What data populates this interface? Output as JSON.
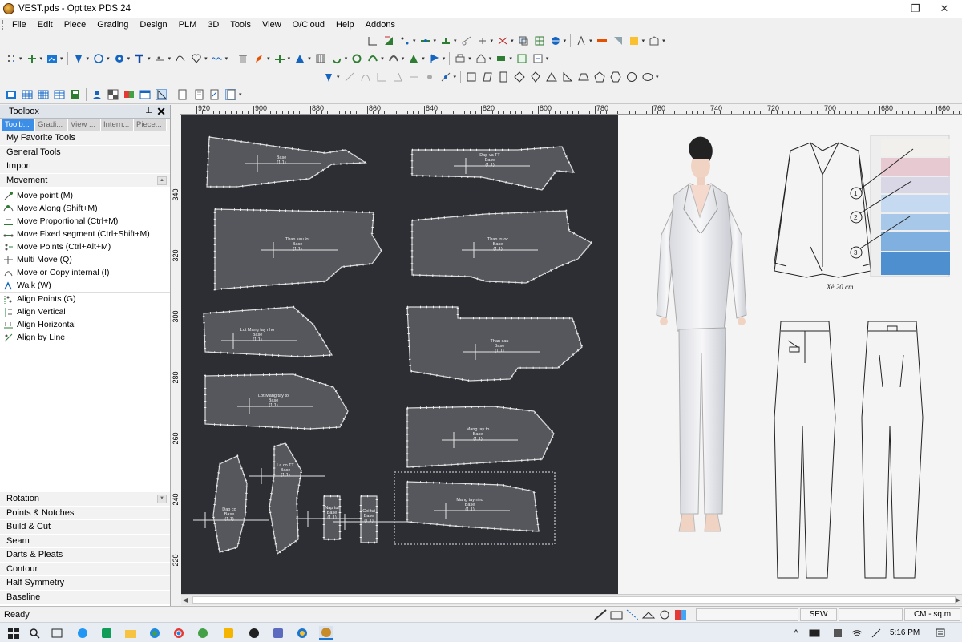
{
  "window": {
    "title": "VEST.pds - Optitex PDS 24",
    "minimize_glyph": "—",
    "restore_glyph": "❐",
    "close_glyph": "✕"
  },
  "menu": [
    "File",
    "Edit",
    "Piece",
    "Grading",
    "Design",
    "PLM",
    "3D",
    "Tools",
    "View",
    "O/Cloud",
    "Help",
    "Addons"
  ],
  "toolbox": {
    "title": "Toolbox",
    "pin": "📌",
    "close": "✕",
    "tabs": [
      "Toolb...",
      "Gradi...",
      "View ...",
      "Intern...",
      "Piece..."
    ],
    "top_categories": [
      "My Favorite Tools",
      "General Tools",
      "Import"
    ],
    "movement": {
      "label": "Movement",
      "tools": [
        {
          "label": "Move point (M)",
          "icon": "move-point-icon"
        },
        {
          "label": "Move Along (Shift+M)",
          "icon": "move-along-icon"
        },
        {
          "label": "Move Proportional (Ctrl+M)",
          "icon": "move-proportional-icon"
        },
        {
          "label": "Move Fixed segment (Ctrl+Shift+M)",
          "icon": "move-fixed-segment-icon"
        },
        {
          "label": "Move Points (Ctrl+Alt+M)",
          "icon": "move-points-icon"
        },
        {
          "label": "Multi Move (Q)",
          "icon": "multi-move-icon"
        },
        {
          "label": "Move or Copy internal (I)",
          "icon": "move-copy-internal-icon"
        },
        {
          "label": "Walk (W)",
          "icon": "walk-icon"
        }
      ],
      "align_tools": [
        {
          "label": "Align Points (G)",
          "icon": "align-points-icon"
        },
        {
          "label": "Align Vertical",
          "icon": "align-vertical-icon"
        },
        {
          "label": "Align Horizontal",
          "icon": "align-horizontal-icon"
        },
        {
          "label": "Align by Line",
          "icon": "align-by-line-icon"
        }
      ]
    },
    "bottom_categories": [
      "Rotation",
      "Points & Notches",
      "Build & Cut",
      "Seam",
      "Darts & Pleats",
      "Contour",
      "Half Symmetry",
      "Baseline"
    ]
  },
  "ruler": {
    "top": [
      "920",
      "900",
      "880",
      "860",
      "840",
      "820",
      "800",
      "780",
      "760",
      "740",
      "720",
      "700",
      "680",
      "660"
    ],
    "left": [
      "340",
      "320",
      "300",
      "280",
      "260",
      "240",
      "220"
    ]
  },
  "pieces": [
    {
      "name": "",
      "base": "Base",
      "size": "(1,1)"
    },
    {
      "name": "Dap va TT",
      "base": "Base",
      "size": "(1,1)"
    },
    {
      "name": "Than sau lot",
      "base": "Base",
      "size": "(1,1)"
    },
    {
      "name": "Than truoc",
      "base": "Base",
      "size": "(1,1)"
    },
    {
      "name": "Lot Mang tay nho",
      "base": "Base",
      "size": "(1,1)"
    },
    {
      "name": "Than sau",
      "base": "Base",
      "size": "(1,1)"
    },
    {
      "name": "Lot Mang tay to",
      "base": "Base",
      "size": "(1,1)"
    },
    {
      "name": "Mang tay to",
      "base": "Base",
      "size": "(1,1)"
    },
    {
      "name": "Dap co",
      "base": "Base",
      "size": "(1,1)"
    },
    {
      "name": "La co TT",
      "base": "Base",
      "size": "(1,1)"
    },
    {
      "name": "Nap tui",
      "base": "Base",
      "size": "(1,1)"
    },
    {
      "name": "Coi tui",
      "base": "Base",
      "size": "(1,1)"
    },
    {
      "name": "Mang tay nho",
      "base": "Base",
      "size": "(1,1)"
    }
  ],
  "reference": {
    "swatch_numbers": [
      "1",
      "2",
      "3"
    ],
    "note": "Xẻ 20 cm",
    "swatch_colors": [
      "#f2f0ec",
      "#e7c9d1",
      "#d9d6e6",
      "#c5daf0",
      "#a8c8ea",
      "#7fb0e0",
      "#4e8fd0"
    ]
  },
  "status": {
    "ready": "Ready",
    "sew": "SEW",
    "units": "CM - sq.m"
  },
  "taskbar": {
    "time": "5:16 PM",
    "up_arrow": "^"
  },
  "colors": {
    "canvas_bg": "#2d2e33",
    "piece_fill": "#55575c",
    "point": "#ffffff",
    "accent_tab": "#3c8ee6"
  }
}
